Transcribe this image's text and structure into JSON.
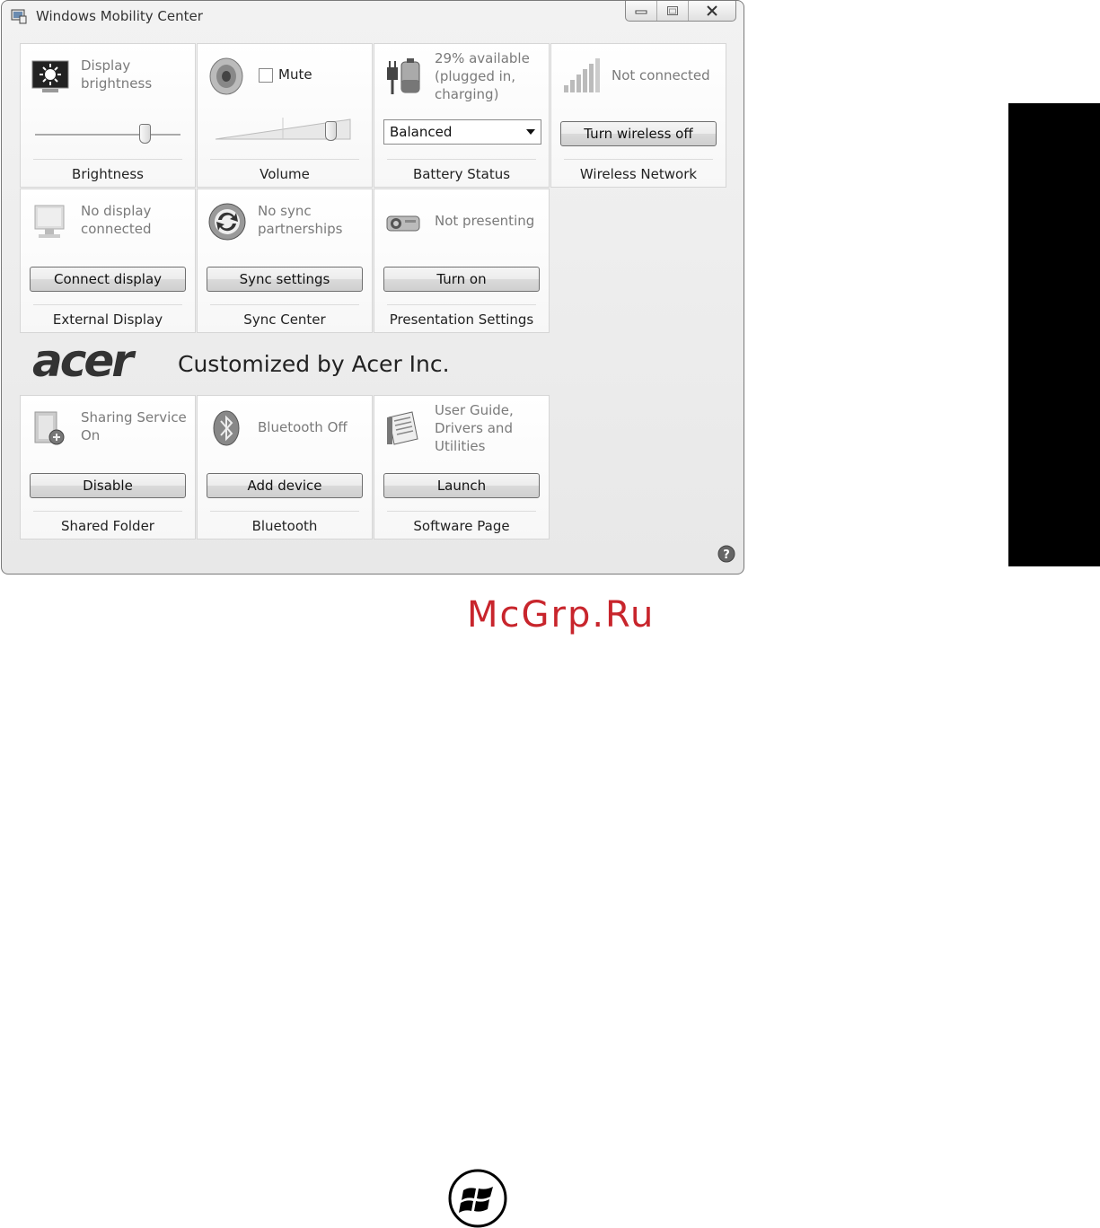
{
  "window": {
    "title": "Windows Mobility Center"
  },
  "tiles": {
    "brightness": {
      "status": "Display brightness",
      "name": "Brightness",
      "level": 0.75
    },
    "volume": {
      "mute_label": "Mute",
      "muted": false,
      "name": "Volume",
      "level": 0.85
    },
    "battery": {
      "status": "29% available (plugged in, charging)",
      "plan": "Balanced",
      "name": "Battery Status"
    },
    "wireless": {
      "status": "Not connected",
      "button": "Turn wireless off",
      "name": "Wireless Network"
    },
    "external_display": {
      "status": "No display connected",
      "button": "Connect display",
      "name": "External Display"
    },
    "sync": {
      "status": "No sync partnerships",
      "button": "Sync settings",
      "name": "Sync Center"
    },
    "presentation": {
      "status": "Not presenting",
      "button": "Turn on",
      "name": "Presentation Settings"
    },
    "shared_folder": {
      "status": "Sharing Service On",
      "button": "Disable",
      "name": "Shared Folder"
    },
    "bluetooth": {
      "status": "Bluetooth Off",
      "button": "Add device",
      "name": "Bluetooth"
    },
    "software": {
      "status": "User Guide, Drivers and Utilities",
      "button": "Launch",
      "name": "Software Page"
    }
  },
  "brand": {
    "logo_text": "acer",
    "caption": "Customized by Acer Inc."
  },
  "watermark": "McGrp.Ru",
  "colors": {
    "watermark": "#c8252c",
    "side_tab": "#000000"
  }
}
